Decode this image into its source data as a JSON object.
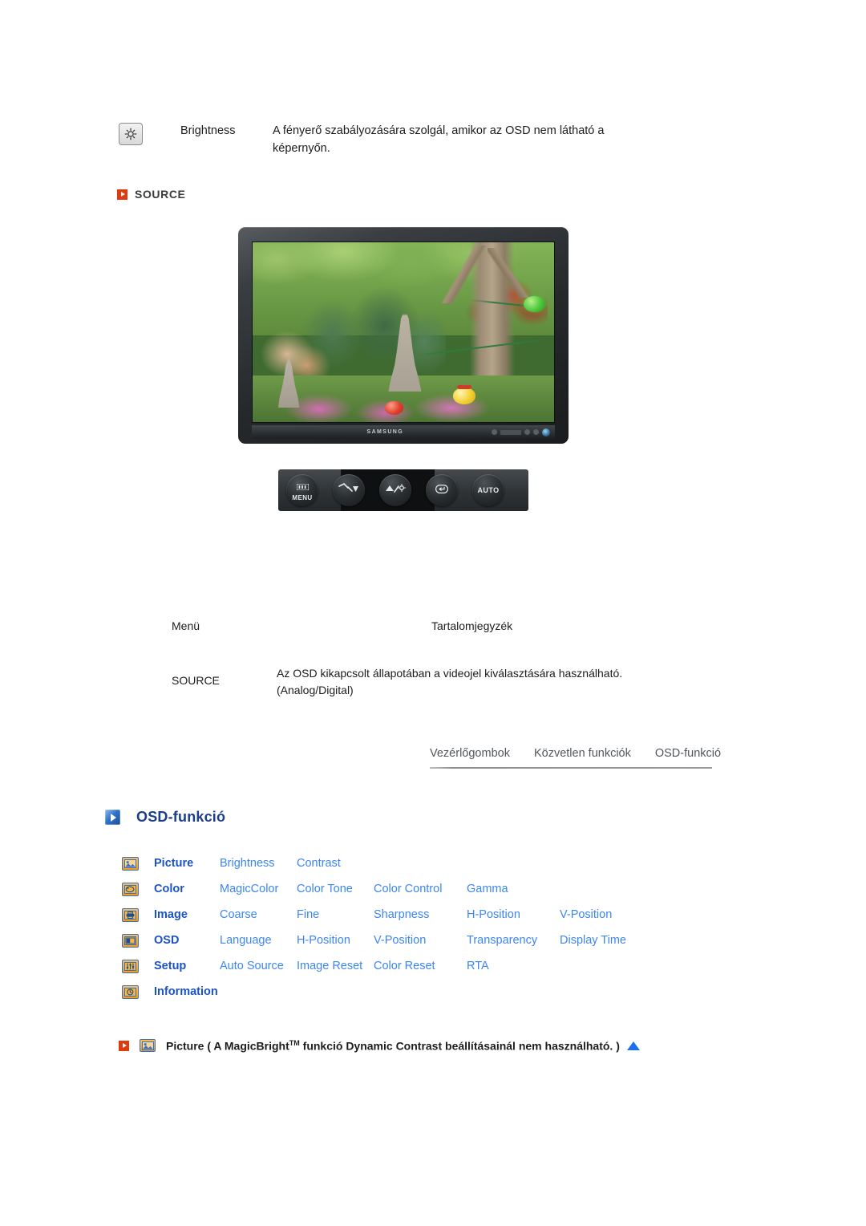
{
  "brightness_row": {
    "icon": "brightness-key-icon",
    "label": "Brightness",
    "description": "A fényerő szabályozására szolgál, amikor az OSD nem látható a képernyőn."
  },
  "source_section": {
    "bullet_icon": "red-play-arrow-icon",
    "heading": "SOURCE",
    "monitor": {
      "brand": "SAMSUNG",
      "alt": "Samsung widescreen monitor displaying a garden scene with stone pagodas and paper lanterns"
    },
    "control_buttons": [
      {
        "name": "menu-button",
        "caption": "MENU",
        "glyph": "menu-bars-icon"
      },
      {
        "name": "down-button",
        "caption": "",
        "glyph": "down-arrow-icon"
      },
      {
        "name": "up-brightness-button",
        "caption": "",
        "glyph": "up-brightness-icon"
      },
      {
        "name": "enter-source-button",
        "caption": "",
        "glyph": "enter-icon"
      },
      {
        "name": "auto-button",
        "caption": "AUTO",
        "glyph": ""
      }
    ],
    "table": {
      "headers": {
        "menu": "Menü",
        "contents": "Tartalomjegyzék"
      },
      "rows": [
        {
          "menu": "SOURCE",
          "contents": "Az OSD kikapcsolt állapotában a videojel kiválasztására használható. (Analog/Digital)"
        }
      ]
    }
  },
  "tabs": [
    {
      "label": "Vezérlőgombok",
      "active": false
    },
    {
      "label": "Közvetlen funkciók",
      "active": false
    },
    {
      "label": "OSD-funkció",
      "active": true
    }
  ],
  "osd_section": {
    "icon": "blue-play-arrow-icon",
    "heading": "OSD-funkció",
    "rows": [
      {
        "icon": "picture-icon",
        "category": "Picture",
        "items": [
          "Brightness",
          "Contrast"
        ]
      },
      {
        "icon": "color-icon",
        "category": "Color",
        "items": [
          "MagicColor",
          "Color Tone",
          "Color Control",
          "Gamma"
        ]
      },
      {
        "icon": "image-icon",
        "category": "Image",
        "items": [
          "Coarse",
          "Fine",
          "Sharpness",
          "H-Position",
          "V-Position"
        ]
      },
      {
        "icon": "osd-icon",
        "category": "OSD",
        "items": [
          "Language",
          "H-Position",
          "V-Position",
          "Transparency",
          "Display Time"
        ]
      },
      {
        "icon": "setup-icon",
        "category": "Setup",
        "items": [
          "Auto Source",
          "Image Reset",
          "Color Reset",
          "RTA"
        ]
      },
      {
        "icon": "information-icon",
        "category": "Information",
        "items": []
      }
    ]
  },
  "footer_note": {
    "bullet_icon": "red-play-arrow-icon",
    "item_icon": "picture-icon",
    "text_before": "Picture ( A MagicBright",
    "trademark": "TM",
    "text_after": " funkció Dynamic Contrast beállításainál nem használható. )",
    "top_arrow_icon": "blue-up-triangle-icon"
  },
  "colors": {
    "red_accent": "#dd3c10",
    "blue_heading": "#1b3e8c",
    "blue_category": "#1b53c4",
    "blue_link": "#3d86f2",
    "icon_orange": "#ef9c23",
    "icon_border_blue": "#3a6fc4",
    "tab_text": "#53575b",
    "body_text": "#1c1c1c"
  }
}
